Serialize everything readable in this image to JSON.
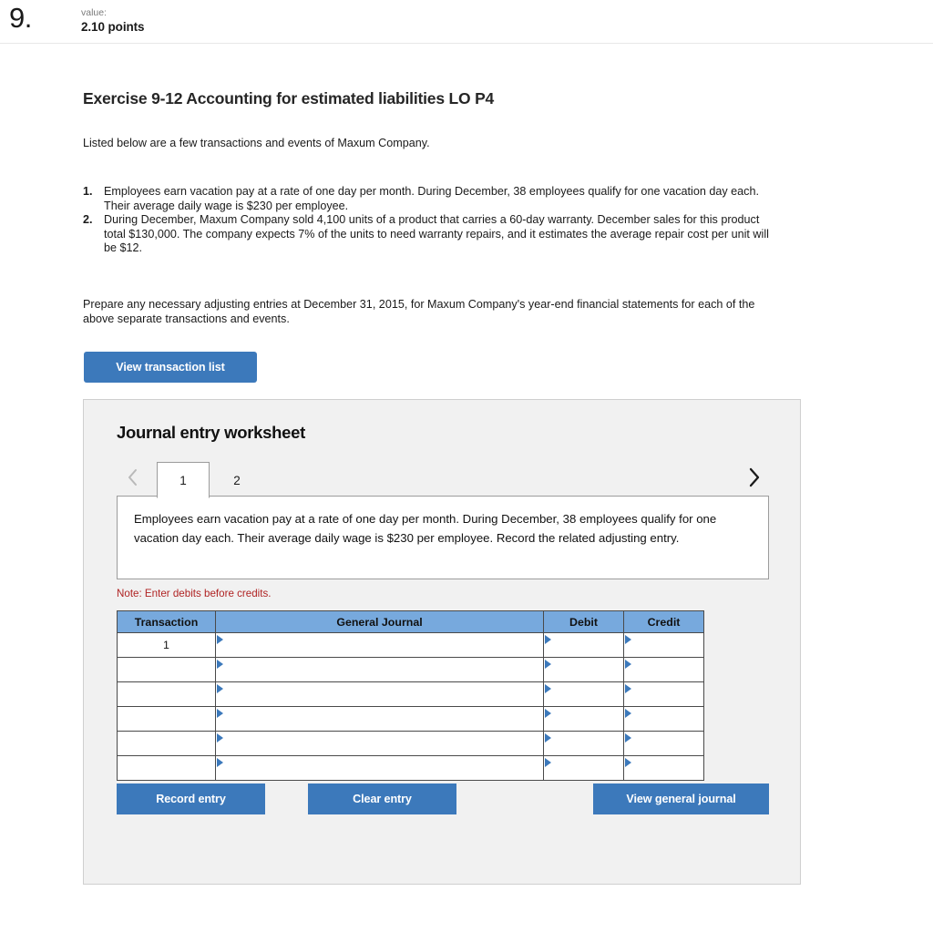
{
  "header": {
    "question_number": "9.",
    "value_label": "value:",
    "points": "2.10 points"
  },
  "exercise": {
    "title": "Exercise 9-12 Accounting for estimated liabilities LO P4",
    "intro": "Listed below are a few transactions and events of Maxum Company.",
    "events": [
      {
        "num": "1.",
        "text": "Employees earn vacation pay at a rate of one day per month. During December, 38 employees qualify for one vacation day each. Their average daily wage is $230 per employee."
      },
      {
        "num": "2.",
        "text": "During December, Maxum Company sold 4,100 units of a product that carries a 60-day warranty. December sales for this product total $130,000. The company expects 7% of the units to need warranty repairs, and it estimates the average repair cost per unit will be $12."
      }
    ],
    "prepare": "Prepare any necessary adjusting entries at December 31, 2015, for Maxum Company's year-end financial statements for each of the above separate transactions and events.",
    "view_transaction_list_label": "View transaction list"
  },
  "worksheet": {
    "title": "Journal entry worksheet",
    "tabs": [
      {
        "label": "1",
        "active": true
      },
      {
        "label": "2",
        "active": false
      }
    ],
    "prev_arrow": "‹",
    "next_arrow": "›",
    "prompt": "Employees earn vacation pay at a rate of one day per month. During December, 38 employees qualify for one vacation day each. Their average daily wage is $230 per employee. Record the related adjusting entry.",
    "note": "Note: Enter debits before credits.",
    "table": {
      "columns": [
        "Transaction",
        "General Journal",
        "Debit",
        "Credit"
      ],
      "rows": [
        {
          "transaction": "1",
          "general_journal": "",
          "debit": "",
          "credit": ""
        },
        {
          "transaction": "",
          "general_journal": "",
          "debit": "",
          "credit": ""
        },
        {
          "transaction": "",
          "general_journal": "",
          "debit": "",
          "credit": ""
        },
        {
          "transaction": "",
          "general_journal": "",
          "debit": "",
          "credit": ""
        },
        {
          "transaction": "",
          "general_journal": "",
          "debit": "",
          "credit": ""
        },
        {
          "transaction": "",
          "general_journal": "",
          "debit": "",
          "credit": ""
        }
      ]
    },
    "buttons": {
      "record_entry": "Record entry",
      "clear_entry": "Clear entry",
      "view_general_journal": "View general journal"
    }
  },
  "colors": {
    "button_blue": "#3c79bb",
    "table_header_blue": "#77a9dd",
    "note_red": "#b02424",
    "panel_gray": "#f1f1f1"
  }
}
